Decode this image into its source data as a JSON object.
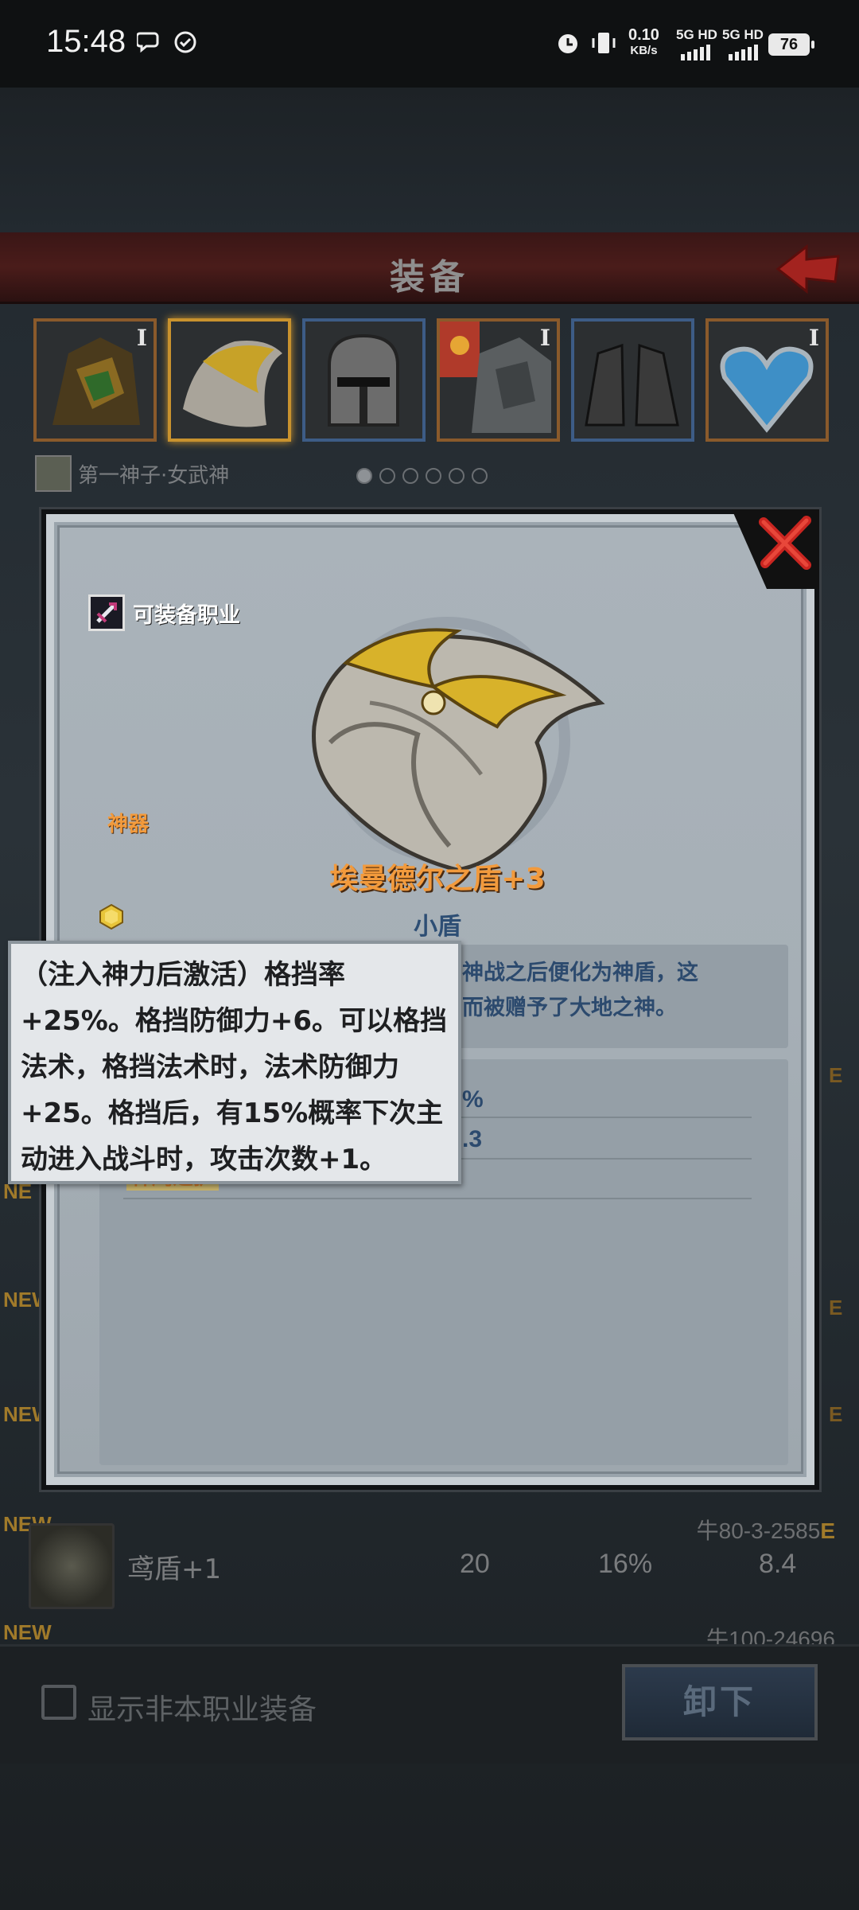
{
  "status_bar": {
    "time": "15:48",
    "net_speed_value": "0.10",
    "net_speed_unit": "KB/s",
    "sim1": "5G HD",
    "sim2": "5G HD",
    "battery": "76"
  },
  "header": {
    "title": "装备"
  },
  "equipment_slots": [
    {
      "name": "dragon-armor",
      "tier": "I",
      "frame": "orange",
      "selected": false
    },
    {
      "name": "winged-shield",
      "tier": "",
      "frame": "gold",
      "selected": true
    },
    {
      "name": "knight-helmet",
      "tier": "",
      "frame": "blue",
      "selected": false
    },
    {
      "name": "sun-armor",
      "tier": "I",
      "frame": "orange",
      "selected": false
    },
    {
      "name": "iron-boots",
      "tier": "",
      "frame": "blue",
      "selected": false
    },
    {
      "name": "blue-amulet",
      "tier": "I",
      "frame": "orange",
      "selected": false
    }
  ],
  "hero": {
    "name": "第一神子·女武神",
    "page_count": 6,
    "current_page": 1
  },
  "dialog": {
    "class_label": "可装备职业",
    "rank_label": "神器",
    "item_name": "埃曼德尔之盾+3",
    "item_type": "小盾",
    "description_line1": "神战之后便化为神盾，这",
    "description_line2": "而被赠予了大地之神。",
    "stat_fragment_1": "%",
    "stat_fragment_2": ".3",
    "skill_name": "神鹰之护"
  },
  "tooltip": {
    "text": "（注入神力后激活）格挡率+25%。格挡防御力+6。可以格挡法术，格挡法术时，法术防御力+25。格挡后，有15%概率下次主动进入战斗时，攻击次数+1。"
  },
  "list": {
    "new_tag": "NEW",
    "side_tag": "NE",
    "edge_tag": "E",
    "row": {
      "name": "鸢盾+1",
      "value1": "20",
      "value2": "16%",
      "value3": "8.4",
      "code": "牛80-3-2585",
      "code_suffix": "E"
    },
    "next_code": "牛100-24696"
  },
  "bottom": {
    "checkbox_label": "显示非本职业装备",
    "unequip_label": "卸下"
  },
  "colors": {
    "accent_orange": "#f29a3c",
    "text_blue": "#2c4a6e",
    "title_red": "#4a1c1a"
  }
}
